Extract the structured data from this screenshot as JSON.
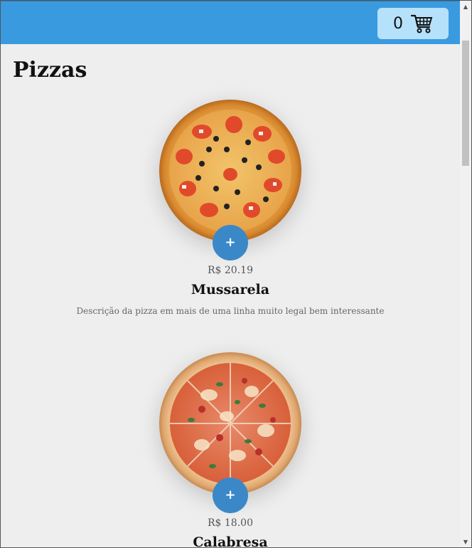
{
  "header": {
    "cart_count": "0",
    "cart_icon": "cart-icon",
    "background": "#3a9ae0",
    "cart_button_background": "#b6e1fb"
  },
  "main": {
    "title": "Pizzas",
    "pizzas": [
      {
        "name": "Mussarela",
        "price": "R$ 20.19",
        "description": "Descrição da pizza em mais de uma linha muito legal bem interessante",
        "add_label": "+"
      },
      {
        "name": "Calabresa",
        "price": "R$ 18.00",
        "add_label": "+"
      }
    ],
    "accent": "#3a88c8"
  },
  "scrollbar": {
    "up_arrow": "▲",
    "down_arrow": "▼"
  }
}
